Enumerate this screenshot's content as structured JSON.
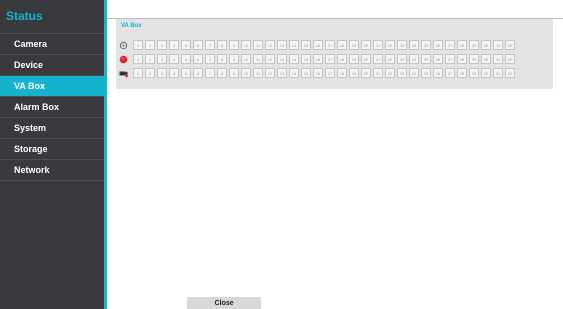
{
  "sidebar": {
    "title": "Status",
    "items": [
      {
        "label": "Camera",
        "active": false
      },
      {
        "label": "Device",
        "active": false
      },
      {
        "label": "VA Box",
        "active": true
      },
      {
        "label": "Alarm Box",
        "active": false
      },
      {
        "label": "System",
        "active": false
      },
      {
        "label": "Storage",
        "active": false
      },
      {
        "label": "Network",
        "active": false
      }
    ]
  },
  "panel": {
    "title": "VA Box",
    "rows": [
      {
        "icon": "motion-detection-icon"
      },
      {
        "icon": "alarm-red-icon"
      },
      {
        "icon": "camera-disconnect-icon"
      }
    ],
    "channels": [
      "1",
      "2",
      "3",
      "4",
      "5",
      "6",
      "7",
      "8",
      "9",
      "10",
      "11",
      "12",
      "13",
      "14",
      "15",
      "16",
      "17",
      "18",
      "19",
      "20",
      "21",
      "22",
      "23",
      "24",
      "25",
      "26",
      "27",
      "28",
      "29",
      "30",
      "31",
      "32"
    ]
  },
  "footer": {
    "close_label": "Close"
  },
  "colors": {
    "accent": "#16b3cf",
    "sidebar_bg": "#383a3d",
    "alarm_red": "#e3262b"
  }
}
